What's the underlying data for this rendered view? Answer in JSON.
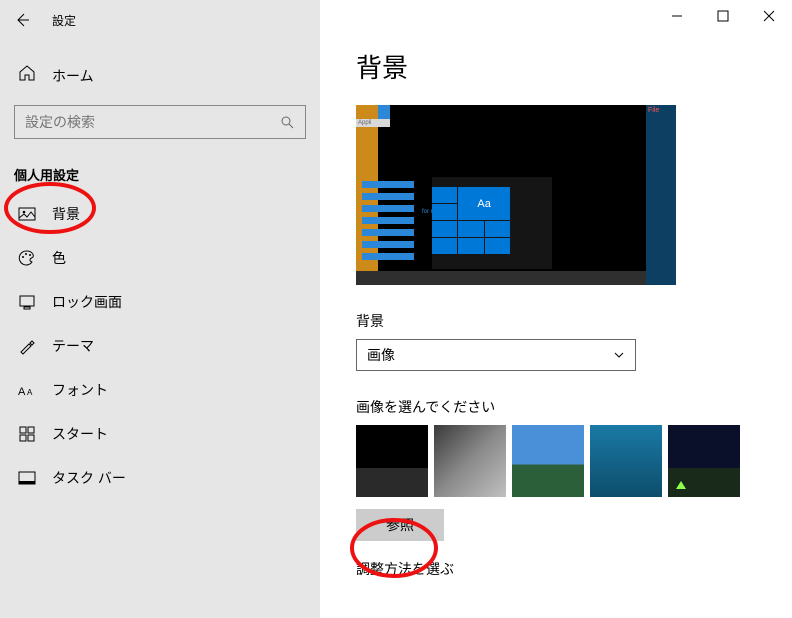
{
  "window": {
    "title": "設定"
  },
  "sidebar": {
    "home": "ホーム",
    "search_placeholder": "設定の検索",
    "section": "個人用設定",
    "items": [
      {
        "label": "背景"
      },
      {
        "label": "色"
      },
      {
        "label": "ロック画面"
      },
      {
        "label": "テーマ"
      },
      {
        "label": "フォント"
      },
      {
        "label": "スタート"
      },
      {
        "label": "タスク バー"
      }
    ]
  },
  "main": {
    "title": "背景",
    "preview": {
      "aa": "Aa",
      "appli": "Appli",
      "file": "File",
      "for_now": "for now"
    },
    "bg_label": "背景",
    "bg_value": "画像",
    "pick_label": "画像を選んでください",
    "browse": "参照",
    "fit_label": "調整方法を選ぶ"
  }
}
